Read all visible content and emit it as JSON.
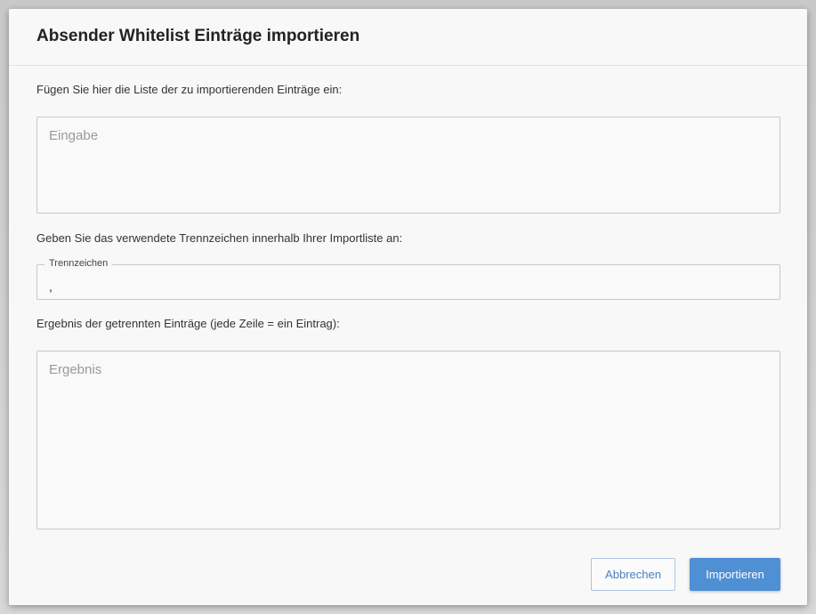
{
  "dialog": {
    "title": "Absender Whitelist Einträge importieren",
    "input_label": "Fügen Sie hier die Liste der zu importierenden Einträge ein:",
    "input_placeholder": "Eingabe",
    "input_value": "",
    "separator_label": "Geben Sie das verwendete Trennzeichen innerhalb Ihrer Importliste an:",
    "separator_field_label": "Trennzeichen",
    "separator_value": ",",
    "result_label": "Ergebnis der getrennten Einträge (jede Zeile = ein Eintrag):",
    "result_placeholder": "Ergebnis",
    "result_value": "",
    "cancel_label": "Abbrechen",
    "import_label": "Importieren"
  },
  "colors": {
    "primary": "#4f8fd4",
    "cancel_text": "#4a82c0"
  }
}
